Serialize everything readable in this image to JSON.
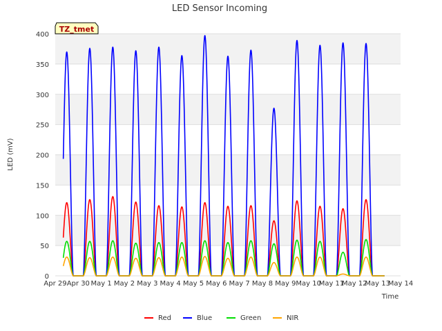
{
  "chart_data": {
    "type": "line",
    "title": "LED Sensor Incoming",
    "xlabel": "Time",
    "ylabel": "LED (mV)",
    "tag_label": "TZ_tmet",
    "x_ticks": [
      "Apr 29",
      "Apr 30",
      "May 1",
      "May 2",
      "May 3",
      "May 4",
      "May 5",
      "May 6",
      "May 7",
      "May 8",
      "May 9",
      "May 10",
      "May 11",
      "May 12",
      "May 13",
      "May 14"
    ],
    "y_ticks": [
      0,
      50,
      100,
      150,
      200,
      250,
      300,
      350,
      400
    ],
    "xlim_days": [
      0,
      15
    ],
    "ylim": [
      0,
      400
    ],
    "x_unit": "days since Apr 29 00:00",
    "grid": true,
    "legend_position": "bottom-center",
    "series": [
      {
        "name": "Red",
        "color": "#ff0000",
        "daily_peaks": [
          121,
          126,
          131,
          122,
          116,
          114,
          121,
          115,
          116,
          91,
          124,
          115,
          111,
          126
        ]
      },
      {
        "name": "Blue",
        "color": "#0000ff",
        "daily_peaks": [
          370,
          376,
          378,
          372,
          378,
          364,
          397,
          363,
          373,
          277,
          389,
          381,
          385,
          384
        ]
      },
      {
        "name": "Green",
        "color": "#00dd00",
        "daily_peaks": [
          57,
          57,
          58,
          54,
          55,
          55,
          58,
          55,
          58,
          53,
          59,
          57,
          39,
          60
        ]
      },
      {
        "name": "NIR",
        "color": "#ffa500",
        "daily_peaks": [
          31,
          30,
          31,
          29,
          30,
          31,
          32,
          29,
          31,
          22,
          31,
          31,
          3,
          31
        ]
      }
    ],
    "peak_day_offset": 0.5
  }
}
